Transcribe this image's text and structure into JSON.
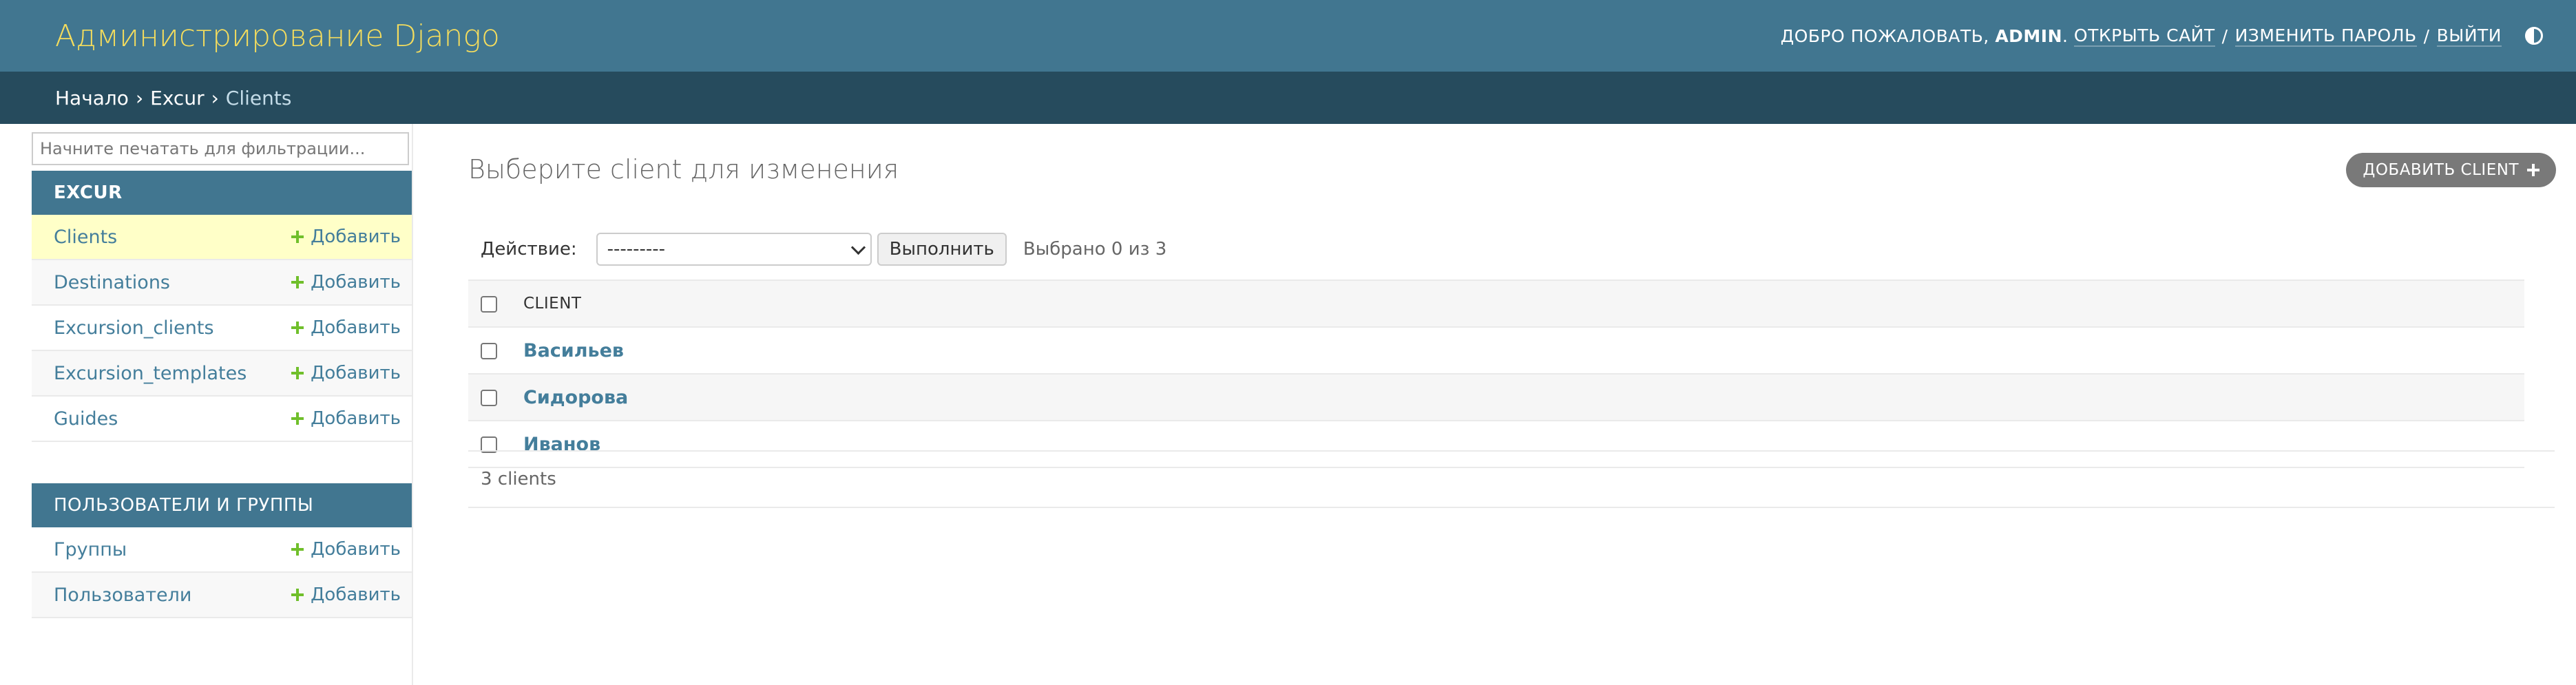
{
  "header": {
    "site_name": "Администрирование Django",
    "welcome": "Добро пожаловать,",
    "username": "admin",
    "view_site": "Открыть сайт",
    "change_password": "Изменить пароль",
    "logout": "Выйти",
    "separator": "/"
  },
  "breadcrumbs": {
    "home": "Начало",
    "app": "Excur",
    "current": "Clients",
    "separator": "›"
  },
  "sidebar": {
    "filter_placeholder": "Начните печатать для фильтрации...",
    "add_label": "Добавить",
    "apps": [
      {
        "name": "Excur",
        "models": [
          "Clients",
          "Destinations",
          "Excursion_clients",
          "Excursion_templates",
          "Guides"
        ]
      },
      {
        "name": "Пользователи и группы",
        "models": [
          "Группы",
          "Пользователи"
        ]
      }
    ]
  },
  "main": {
    "title": "Выберите client для изменения",
    "add_button": "Добавить client",
    "actions": {
      "label": "Действие:",
      "selected_option": "---------",
      "go_button": "Выполнить",
      "counter": "Выбрано 0 из 3"
    },
    "table": {
      "column": "Client",
      "rows": [
        "Васильев",
        "Сидорова",
        "Иванов"
      ]
    },
    "paginator": "3 clients"
  },
  "colors": {
    "header_bg": "#417690",
    "breadcrumbs_bg": "#264b5d",
    "brand": "#f5dd5d",
    "link": "#447e9b",
    "add_icon": "#70bf2b",
    "current_row": "#ffffc8"
  },
  "icons": {
    "theme_toggle": "half-circle-icon",
    "add": "plus-icon",
    "select_arrow": "chevron-down-icon"
  }
}
